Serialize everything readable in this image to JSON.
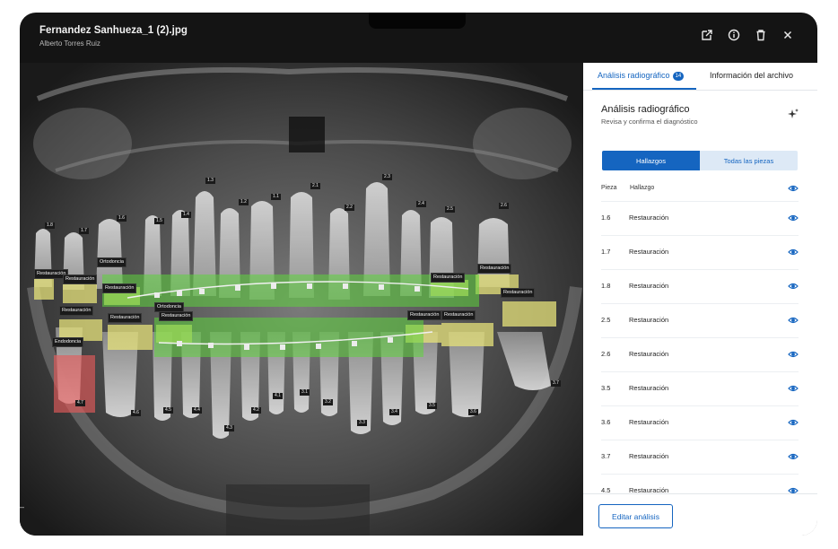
{
  "header": {
    "file_name": "Fernandez Sanhueza_1 (2).jpg",
    "patient": "Alberto Torres Ruiz",
    "icons": [
      "external-link-icon",
      "info-icon",
      "trash-icon",
      "close-icon"
    ]
  },
  "panel": {
    "tabs": [
      {
        "label": "Análisis radiográfico",
        "badge": "14",
        "active": true
      },
      {
        "label": "Información del archivo",
        "active": false
      }
    ],
    "title": "Análisis radiográfico",
    "subtitle": "Revisa y confirma el diagnóstico",
    "segments": {
      "hallazgos": "Hallazgos",
      "todas": "Todas las piezas",
      "selected": "Hallazgos"
    },
    "table": {
      "col_pieza": "Pieza",
      "col_hallazgo": "Hallazgo",
      "rows": [
        {
          "pieza": "1.6",
          "hallazgo": "Restauración"
        },
        {
          "pieza": "1.7",
          "hallazgo": "Restauración"
        },
        {
          "pieza": "1.8",
          "hallazgo": "Restauración"
        },
        {
          "pieza": "2.5",
          "hallazgo": "Restauración"
        },
        {
          "pieza": "2.6",
          "hallazgo": "Restauración"
        },
        {
          "pieza": "3.5",
          "hallazgo": "Restauración"
        },
        {
          "pieza": "3.6",
          "hallazgo": "Restauración"
        },
        {
          "pieza": "3.7",
          "hallazgo": "Restauración"
        },
        {
          "pieza": "4.5",
          "hallazgo": "Restauración"
        }
      ]
    },
    "edit_button": "Editar análisis"
  },
  "xray": {
    "colors": {
      "restauracion": "#e6e27a",
      "ortodoncia": "#5ed43d",
      "endodoncia": "#e35a5a"
    },
    "labels": {
      "restauracion": "Restauración",
      "ortodoncia": "Ortodoncia",
      "endodoncia": "Endodoncia"
    },
    "tooth_numbers": [
      "1.8",
      "1.7",
      "1.6",
      "1.5",
      "1.4",
      "1.3",
      "1.2",
      "1.1",
      "2.1",
      "2.2",
      "2.3",
      "2.4",
      "2.5",
      "2.6",
      "4.7",
      "4.6",
      "4.5",
      "4.4",
      "4.3",
      "4.2",
      "4.1",
      "3.1",
      "3.2",
      "3.3",
      "3.4",
      "3.5",
      "3.6",
      "3.7"
    ]
  }
}
